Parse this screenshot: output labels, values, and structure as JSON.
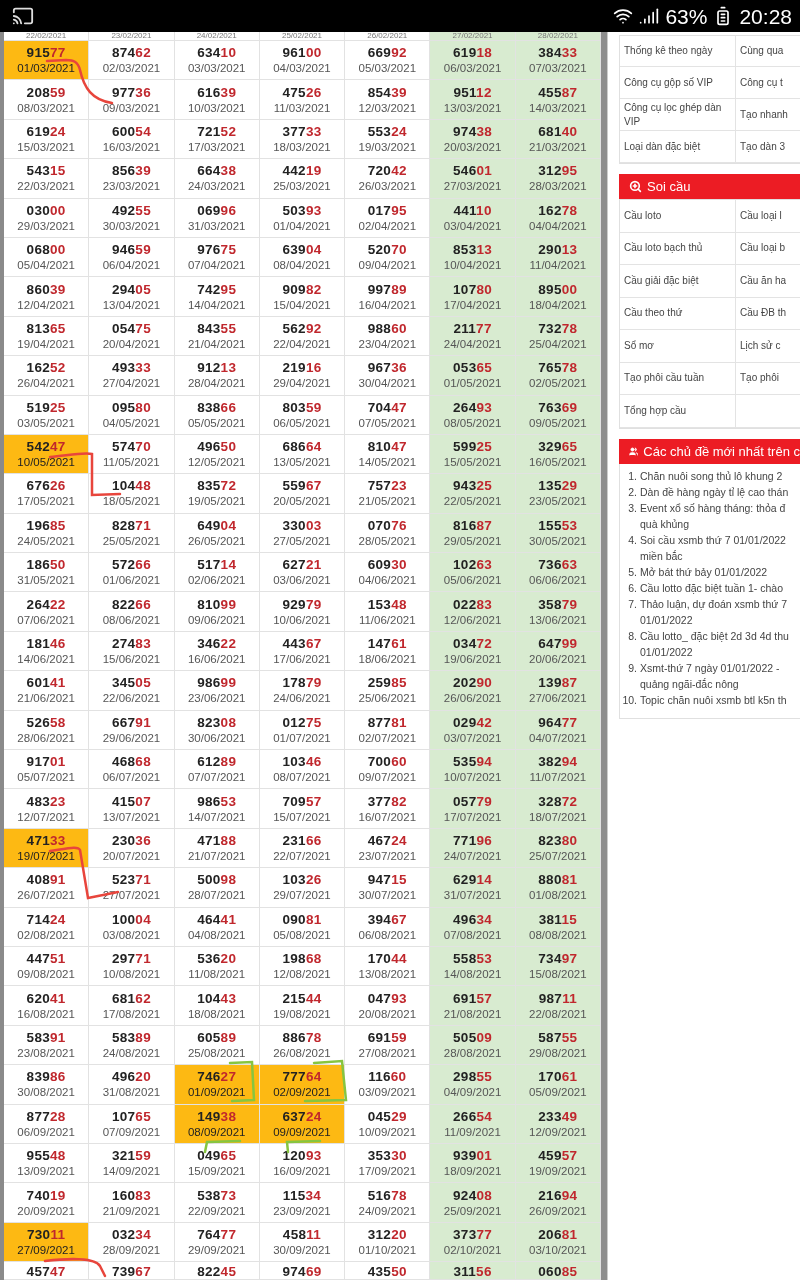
{
  "status_bar": {
    "battery": "63%",
    "time": "20:28"
  },
  "results": {
    "columns": [
      {
        "shaded": false
      },
      {
        "shaded": false
      },
      {
        "shaded": false
      },
      {
        "shaded": false
      },
      {
        "shaded": false
      },
      {
        "shaded": true
      },
      {
        "shaded": true
      }
    ],
    "top_row_dates": [
      "22/02/2021",
      "23/02/2021",
      "24/02/2021",
      "25/02/2021",
      "26/02/2021",
      "27/02/2021",
      "28/02/2021"
    ],
    "rows": [
      {
        "cells": [
          {
            "number": "91577",
            "date": "01/03/2021",
            "highlighted": true
          },
          {
            "number": "87462",
            "date": "02/03/2021",
            "highlighted": false
          },
          {
            "number": "63410",
            "date": "03/03/2021",
            "highlighted": false
          },
          {
            "number": "96100",
            "date": "04/03/2021",
            "highlighted": false
          },
          {
            "number": "66992",
            "date": "05/03/2021",
            "highlighted": false
          },
          {
            "number": "61918",
            "date": "06/03/2021",
            "highlighted": false
          },
          {
            "number": "38433",
            "date": "07/03/2021",
            "highlighted": false
          }
        ]
      },
      {
        "cells": [
          {
            "number": "20859",
            "date": "08/03/2021",
            "highlighted": false
          },
          {
            "number": "97736",
            "date": "09/03/2021",
            "highlighted": false
          },
          {
            "number": "61639",
            "date": "10/03/2021",
            "highlighted": false
          },
          {
            "number": "47526",
            "date": "11/03/2021",
            "highlighted": false
          },
          {
            "number": "85439",
            "date": "12/03/2021",
            "highlighted": false
          },
          {
            "number": "95112",
            "date": "13/03/2021",
            "highlighted": false
          },
          {
            "number": "45587",
            "date": "14/03/2021",
            "highlighted": false
          }
        ]
      },
      {
        "cells": [
          {
            "number": "61924",
            "date": "15/03/2021",
            "highlighted": false
          },
          {
            "number": "60054",
            "date": "16/03/2021",
            "highlighted": false
          },
          {
            "number": "72152",
            "date": "17/03/2021",
            "highlighted": false
          },
          {
            "number": "37733",
            "date": "18/03/2021",
            "highlighted": false
          },
          {
            "number": "55324",
            "date": "19/03/2021",
            "highlighted": false
          },
          {
            "number": "97438",
            "date": "20/03/2021",
            "highlighted": false
          },
          {
            "number": "68140",
            "date": "21/03/2021",
            "highlighted": false
          }
        ]
      },
      {
        "cells": [
          {
            "number": "54315",
            "date": "22/03/2021",
            "highlighted": false
          },
          {
            "number": "85639",
            "date": "23/03/2021",
            "highlighted": false
          },
          {
            "number": "66438",
            "date": "24/03/2021",
            "highlighted": false
          },
          {
            "number": "44219",
            "date": "25/03/2021",
            "highlighted": false
          },
          {
            "number": "72042",
            "date": "26/03/2021",
            "highlighted": false
          },
          {
            "number": "54601",
            "date": "27/03/2021",
            "highlighted": false
          },
          {
            "number": "31295",
            "date": "28/03/2021",
            "highlighted": false
          }
        ]
      },
      {
        "cells": [
          {
            "number": "03000",
            "date": "29/03/2021",
            "highlighted": false
          },
          {
            "number": "49255",
            "date": "30/03/2021",
            "highlighted": false
          },
          {
            "number": "06996",
            "date": "31/03/2021",
            "highlighted": false
          },
          {
            "number": "50393",
            "date": "01/04/2021",
            "highlighted": false
          },
          {
            "number": "01795",
            "date": "02/04/2021",
            "highlighted": false
          },
          {
            "number": "44110",
            "date": "03/04/2021",
            "highlighted": false
          },
          {
            "number": "16278",
            "date": "04/04/2021",
            "highlighted": false
          }
        ]
      },
      {
        "cells": [
          {
            "number": "06800",
            "date": "05/04/2021",
            "highlighted": false
          },
          {
            "number": "94659",
            "date": "06/04/2021",
            "highlighted": false
          },
          {
            "number": "97675",
            "date": "07/04/2021",
            "highlighted": false
          },
          {
            "number": "63904",
            "date": "08/04/2021",
            "highlighted": false
          },
          {
            "number": "52070",
            "date": "09/04/2021",
            "highlighted": false
          },
          {
            "number": "85313",
            "date": "10/04/2021",
            "highlighted": false
          },
          {
            "number": "29013",
            "date": "11/04/2021",
            "highlighted": false
          }
        ]
      },
      {
        "cells": [
          {
            "number": "86039",
            "date": "12/04/2021",
            "highlighted": false
          },
          {
            "number": "29405",
            "date": "13/04/2021",
            "highlighted": false
          },
          {
            "number": "74295",
            "date": "14/04/2021",
            "highlighted": false
          },
          {
            "number": "90982",
            "date": "15/04/2021",
            "highlighted": false
          },
          {
            "number": "99789",
            "date": "16/04/2021",
            "highlighted": false
          },
          {
            "number": "10780",
            "date": "17/04/2021",
            "highlighted": false
          },
          {
            "number": "89500",
            "date": "18/04/2021",
            "highlighted": false
          }
        ]
      },
      {
        "cells": [
          {
            "number": "81365",
            "date": "19/04/2021",
            "highlighted": false
          },
          {
            "number": "05475",
            "date": "20/04/2021",
            "highlighted": false
          },
          {
            "number": "84355",
            "date": "21/04/2021",
            "highlighted": false
          },
          {
            "number": "56292",
            "date": "22/04/2021",
            "highlighted": false
          },
          {
            "number": "98860",
            "date": "23/04/2021",
            "highlighted": false
          },
          {
            "number": "21177",
            "date": "24/04/2021",
            "highlighted": false
          },
          {
            "number": "73278",
            "date": "25/04/2021",
            "highlighted": false
          }
        ]
      },
      {
        "cells": [
          {
            "number": "16252",
            "date": "26/04/2021",
            "highlighted": false
          },
          {
            "number": "49333",
            "date": "27/04/2021",
            "highlighted": false
          },
          {
            "number": "91213",
            "date": "28/04/2021",
            "highlighted": false
          },
          {
            "number": "21916",
            "date": "29/04/2021",
            "highlighted": false
          },
          {
            "number": "96736",
            "date": "30/04/2021",
            "highlighted": false
          },
          {
            "number": "05365",
            "date": "01/05/2021",
            "highlighted": false
          },
          {
            "number": "76578",
            "date": "02/05/2021",
            "highlighted": false
          }
        ]
      },
      {
        "cells": [
          {
            "number": "51925",
            "date": "03/05/2021",
            "highlighted": false
          },
          {
            "number": "09580",
            "date": "04/05/2021",
            "highlighted": false
          },
          {
            "number": "83866",
            "date": "05/05/2021",
            "highlighted": false
          },
          {
            "number": "80359",
            "date": "06/05/2021",
            "highlighted": false
          },
          {
            "number": "70447",
            "date": "07/05/2021",
            "highlighted": false
          },
          {
            "number": "26493",
            "date": "08/05/2021",
            "highlighted": false
          },
          {
            "number": "76369",
            "date": "09/05/2021",
            "highlighted": false
          }
        ]
      },
      {
        "cells": [
          {
            "number": "54247",
            "date": "10/05/2021",
            "highlighted": true
          },
          {
            "number": "57470",
            "date": "11/05/2021",
            "highlighted": false
          },
          {
            "number": "49650",
            "date": "12/05/2021",
            "highlighted": false
          },
          {
            "number": "68664",
            "date": "13/05/2021",
            "highlighted": false
          },
          {
            "number": "81047",
            "date": "14/05/2021",
            "highlighted": false
          },
          {
            "number": "59925",
            "date": "15/05/2021",
            "highlighted": false
          },
          {
            "number": "32965",
            "date": "16/05/2021",
            "highlighted": false
          }
        ]
      },
      {
        "cells": [
          {
            "number": "67626",
            "date": "17/05/2021",
            "highlighted": false
          },
          {
            "number": "10448",
            "date": "18/05/2021",
            "highlighted": false
          },
          {
            "number": "83572",
            "date": "19/05/2021",
            "highlighted": false
          },
          {
            "number": "55967",
            "date": "20/05/2021",
            "highlighted": false
          },
          {
            "number": "75723",
            "date": "21/05/2021",
            "highlighted": false
          },
          {
            "number": "94325",
            "date": "22/05/2021",
            "highlighted": false
          },
          {
            "number": "13529",
            "date": "23/05/2021",
            "highlighted": false
          }
        ]
      },
      {
        "cells": [
          {
            "number": "19685",
            "date": "24/05/2021",
            "highlighted": false
          },
          {
            "number": "82871",
            "date": "25/05/2021",
            "highlighted": false
          },
          {
            "number": "64904",
            "date": "26/05/2021",
            "highlighted": false
          },
          {
            "number": "33003",
            "date": "27/05/2021",
            "highlighted": false
          },
          {
            "number": "07076",
            "date": "28/05/2021",
            "highlighted": false
          },
          {
            "number": "81687",
            "date": "29/05/2021",
            "highlighted": false
          },
          {
            "number": "15553",
            "date": "30/05/2021",
            "highlighted": false
          }
        ]
      },
      {
        "cells": [
          {
            "number": "18650",
            "date": "31/05/2021",
            "highlighted": false
          },
          {
            "number": "57266",
            "date": "01/06/2021",
            "highlighted": false
          },
          {
            "number": "51714",
            "date": "02/06/2021",
            "highlighted": false
          },
          {
            "number": "62721",
            "date": "03/06/2021",
            "highlighted": false
          },
          {
            "number": "60930",
            "date": "04/06/2021",
            "highlighted": false
          },
          {
            "number": "10263",
            "date": "05/06/2021",
            "highlighted": false
          },
          {
            "number": "73663",
            "date": "06/06/2021",
            "highlighted": false
          }
        ]
      },
      {
        "cells": [
          {
            "number": "26422",
            "date": "07/06/2021",
            "highlighted": false
          },
          {
            "number": "82266",
            "date": "08/06/2021",
            "highlighted": false
          },
          {
            "number": "81099",
            "date": "09/06/2021",
            "highlighted": false
          },
          {
            "number": "92979",
            "date": "10/06/2021",
            "highlighted": false
          },
          {
            "number": "15348",
            "date": "11/06/2021",
            "highlighted": false
          },
          {
            "number": "02283",
            "date": "12/06/2021",
            "highlighted": false
          },
          {
            "number": "35879",
            "date": "13/06/2021",
            "highlighted": false
          }
        ]
      },
      {
        "cells": [
          {
            "number": "18146",
            "date": "14/06/2021",
            "highlighted": false
          },
          {
            "number": "27483",
            "date": "15/06/2021",
            "highlighted": false
          },
          {
            "number": "34622",
            "date": "16/06/2021",
            "highlighted": false
          },
          {
            "number": "44367",
            "date": "17/06/2021",
            "highlighted": false
          },
          {
            "number": "14761",
            "date": "18/06/2021",
            "highlighted": false
          },
          {
            "number": "03472",
            "date": "19/06/2021",
            "highlighted": false
          },
          {
            "number": "64799",
            "date": "20/06/2021",
            "highlighted": false
          }
        ]
      },
      {
        "cells": [
          {
            "number": "60141",
            "date": "21/06/2021",
            "highlighted": false
          },
          {
            "number": "34505",
            "date": "22/06/2021",
            "highlighted": false
          },
          {
            "number": "98699",
            "date": "23/06/2021",
            "highlighted": false
          },
          {
            "number": "17879",
            "date": "24/06/2021",
            "highlighted": false
          },
          {
            "number": "25985",
            "date": "25/06/2021",
            "highlighted": false
          },
          {
            "number": "20290",
            "date": "26/06/2021",
            "highlighted": false
          },
          {
            "number": "13987",
            "date": "27/06/2021",
            "highlighted": false
          }
        ]
      },
      {
        "cells": [
          {
            "number": "52658",
            "date": "28/06/2021",
            "highlighted": false
          },
          {
            "number": "66791",
            "date": "29/06/2021",
            "highlighted": false
          },
          {
            "number": "82308",
            "date": "30/06/2021",
            "highlighted": false
          },
          {
            "number": "01275",
            "date": "01/07/2021",
            "highlighted": false
          },
          {
            "number": "87781",
            "date": "02/07/2021",
            "highlighted": false
          },
          {
            "number": "02942",
            "date": "03/07/2021",
            "highlighted": false
          },
          {
            "number": "96477",
            "date": "04/07/2021",
            "highlighted": false
          }
        ]
      },
      {
        "cells": [
          {
            "number": "91701",
            "date": "05/07/2021",
            "highlighted": false
          },
          {
            "number": "46868",
            "date": "06/07/2021",
            "highlighted": false
          },
          {
            "number": "61289",
            "date": "07/07/2021",
            "highlighted": false
          },
          {
            "number": "10346",
            "date": "08/07/2021",
            "highlighted": false
          },
          {
            "number": "70060",
            "date": "09/07/2021",
            "highlighted": false
          },
          {
            "number": "53594",
            "date": "10/07/2021",
            "highlighted": false
          },
          {
            "number": "38294",
            "date": "11/07/2021",
            "highlighted": false
          }
        ]
      },
      {
        "cells": [
          {
            "number": "48323",
            "date": "12/07/2021",
            "highlighted": false
          },
          {
            "number": "41507",
            "date": "13/07/2021",
            "highlighted": false
          },
          {
            "number": "98653",
            "date": "14/07/2021",
            "highlighted": false
          },
          {
            "number": "70957",
            "date": "15/07/2021",
            "highlighted": false
          },
          {
            "number": "37782",
            "date": "16/07/2021",
            "highlighted": false
          },
          {
            "number": "05779",
            "date": "17/07/2021",
            "highlighted": false
          },
          {
            "number": "32872",
            "date": "18/07/2021",
            "highlighted": false
          }
        ]
      },
      {
        "cells": [
          {
            "number": "47133",
            "date": "19/07/2021",
            "highlighted": true
          },
          {
            "number": "23036",
            "date": "20/07/2021",
            "highlighted": false
          },
          {
            "number": "47188",
            "date": "21/07/2021",
            "highlighted": false
          },
          {
            "number": "23166",
            "date": "22/07/2021",
            "highlighted": false
          },
          {
            "number": "46724",
            "date": "23/07/2021",
            "highlighted": false
          },
          {
            "number": "77196",
            "date": "24/07/2021",
            "highlighted": false
          },
          {
            "number": "82380",
            "date": "25/07/2021",
            "highlighted": false
          }
        ]
      },
      {
        "cells": [
          {
            "number": "40891",
            "date": "26/07/2021",
            "highlighted": false
          },
          {
            "number": "52371",
            "date": "27/07/2021",
            "highlighted": false
          },
          {
            "number": "50098",
            "date": "28/07/2021",
            "highlighted": false
          },
          {
            "number": "10326",
            "date": "29/07/2021",
            "highlighted": false
          },
          {
            "number": "94715",
            "date": "30/07/2021",
            "highlighted": false
          },
          {
            "number": "62914",
            "date": "31/07/2021",
            "highlighted": false
          },
          {
            "number": "88081",
            "date": "01/08/2021",
            "highlighted": false
          }
        ]
      },
      {
        "cells": [
          {
            "number": "71424",
            "date": "02/08/2021",
            "highlighted": false
          },
          {
            "number": "10004",
            "date": "03/08/2021",
            "highlighted": false
          },
          {
            "number": "46441",
            "date": "04/08/2021",
            "highlighted": false
          },
          {
            "number": "09081",
            "date": "05/08/2021",
            "highlighted": false
          },
          {
            "number": "39467",
            "date": "06/08/2021",
            "highlighted": false
          },
          {
            "number": "49634",
            "date": "07/08/2021",
            "highlighted": false
          },
          {
            "number": "38115",
            "date": "08/08/2021",
            "highlighted": false
          }
        ]
      },
      {
        "cells": [
          {
            "number": "44751",
            "date": "09/08/2021",
            "highlighted": false
          },
          {
            "number": "29771",
            "date": "10/08/2021",
            "highlighted": false
          },
          {
            "number": "53620",
            "date": "11/08/2021",
            "highlighted": false
          },
          {
            "number": "19868",
            "date": "12/08/2021",
            "highlighted": false
          },
          {
            "number": "17044",
            "date": "13/08/2021",
            "highlighted": false
          },
          {
            "number": "55853",
            "date": "14/08/2021",
            "highlighted": false
          },
          {
            "number": "73497",
            "date": "15/08/2021",
            "highlighted": false
          }
        ]
      },
      {
        "cells": [
          {
            "number": "62041",
            "date": "16/08/2021",
            "highlighted": false
          },
          {
            "number": "68162",
            "date": "17/08/2021",
            "highlighted": false
          },
          {
            "number": "10443",
            "date": "18/08/2021",
            "highlighted": false
          },
          {
            "number": "21544",
            "date": "19/08/2021",
            "highlighted": false
          },
          {
            "number": "04793",
            "date": "20/08/2021",
            "highlighted": false
          },
          {
            "number": "69157",
            "date": "21/08/2021",
            "highlighted": false
          },
          {
            "number": "98711",
            "date": "22/08/2021",
            "highlighted": false
          }
        ]
      },
      {
        "cells": [
          {
            "number": "58391",
            "date": "23/08/2021",
            "highlighted": false
          },
          {
            "number": "58389",
            "date": "24/08/2021",
            "highlighted": false
          },
          {
            "number": "60589",
            "date": "25/08/2021",
            "highlighted": false
          },
          {
            "number": "88678",
            "date": "26/08/2021",
            "highlighted": false
          },
          {
            "number": "69159",
            "date": "27/08/2021",
            "highlighted": false
          },
          {
            "number": "50509",
            "date": "28/08/2021",
            "highlighted": false
          },
          {
            "number": "58755",
            "date": "29/08/2021",
            "highlighted": false
          }
        ]
      },
      {
        "cells": [
          {
            "number": "83986",
            "date": "30/08/2021",
            "highlighted": false
          },
          {
            "number": "49620",
            "date": "31/08/2021",
            "highlighted": false
          },
          {
            "number": "74627",
            "date": "01/09/2021",
            "highlighted": true
          },
          {
            "number": "77764",
            "date": "02/09/2021",
            "highlighted": true
          },
          {
            "number": "11660",
            "date": "03/09/2021",
            "highlighted": false
          },
          {
            "number": "29855",
            "date": "04/09/2021",
            "highlighted": false
          },
          {
            "number": "17061",
            "date": "05/09/2021",
            "highlighted": false
          }
        ]
      },
      {
        "cells": [
          {
            "number": "87728",
            "date": "06/09/2021",
            "highlighted": false
          },
          {
            "number": "10765",
            "date": "07/09/2021",
            "highlighted": false
          },
          {
            "number": "14938",
            "date": "08/09/2021",
            "highlighted": true
          },
          {
            "number": "63724",
            "date": "09/09/2021",
            "highlighted": true
          },
          {
            "number": "04529",
            "date": "10/09/2021",
            "highlighted": false
          },
          {
            "number": "26654",
            "date": "11/09/2021",
            "highlighted": false
          },
          {
            "number": "23349",
            "date": "12/09/2021",
            "highlighted": false
          }
        ]
      },
      {
        "cells": [
          {
            "number": "95548",
            "date": "13/09/2021",
            "highlighted": false
          },
          {
            "number": "32159",
            "date": "14/09/2021",
            "highlighted": false
          },
          {
            "number": "04965",
            "date": "15/09/2021",
            "highlighted": false
          },
          {
            "number": "12093",
            "date": "16/09/2021",
            "highlighted": false
          },
          {
            "number": "35330",
            "date": "17/09/2021",
            "highlighted": false
          },
          {
            "number": "93901",
            "date": "18/09/2021",
            "highlighted": false
          },
          {
            "number": "45957",
            "date": "19/09/2021",
            "highlighted": false
          }
        ]
      },
      {
        "cells": [
          {
            "number": "74019",
            "date": "20/09/2021",
            "highlighted": false
          },
          {
            "number": "16083",
            "date": "21/09/2021",
            "highlighted": false
          },
          {
            "number": "53873",
            "date": "22/09/2021",
            "highlighted": false
          },
          {
            "number": "11534",
            "date": "23/09/2021",
            "highlighted": false
          },
          {
            "number": "51678",
            "date": "24/09/2021",
            "highlighted": false
          },
          {
            "number": "92408",
            "date": "25/09/2021",
            "highlighted": false
          },
          {
            "number": "21694",
            "date": "26/09/2021",
            "highlighted": false
          }
        ]
      },
      {
        "cells": [
          {
            "number": "73011",
            "date": "27/09/2021",
            "highlighted": true
          },
          {
            "number": "03234",
            "date": "28/09/2021",
            "highlighted": false
          },
          {
            "number": "76477",
            "date": "29/09/2021",
            "highlighted": false
          },
          {
            "number": "45811",
            "date": "30/09/2021",
            "highlighted": false
          },
          {
            "number": "31220",
            "date": "01/10/2021",
            "highlighted": false
          },
          {
            "number": "37377",
            "date": "02/10/2021",
            "highlighted": false
          },
          {
            "number": "20681",
            "date": "03/10/2021",
            "highlighted": false
          }
        ]
      }
    ],
    "bottom_row_numbers": [
      "45747",
      "73967",
      "82245",
      "97469",
      "43550",
      "31156",
      "06085"
    ],
    "annotations": [
      {
        "color": "#e8453c"
      },
      {
        "color": "#e8453c"
      },
      {
        "color": "#e8453c"
      },
      {
        "color": "#e8453c"
      },
      {
        "color": "#86c540"
      },
      {
        "color": "#86c540"
      },
      {
        "color": "#86c540"
      },
      {
        "color": "#86c540"
      }
    ]
  },
  "side_panel": {
    "tools": {
      "rows": [
        {
          "left": "Thống kê theo ngày",
          "right": "Cùng qua"
        },
        {
          "left": "Công cụ gộp số VIP",
          "right": "Công cụ t"
        },
        {
          "left": "Công cụ lọc ghép dàn VIP",
          "right": "Tạo nhanh"
        },
        {
          "left": "Loại dàn đặc biệt",
          "right": "Tạo dàn 3"
        }
      ]
    },
    "soi_cau": {
      "title": "Soi cầu",
      "rows": [
        {
          "left": "Cầu loto",
          "right": "Cầu loại l"
        },
        {
          "left": "Cầu loto bạch thủ",
          "right": "Cầu loại b"
        },
        {
          "left": "Cầu giải đặc biệt",
          "right": "Cầu ăn ha"
        },
        {
          "left": "Cầu theo thứ",
          "right": "Cầu ĐB th"
        },
        {
          "left": "Sổ mơ",
          "right": "Lịch sử c"
        },
        {
          "left": "Tạo phôi cầu tuần",
          "right": "Tạo phôi"
        },
        {
          "left": "Tổng hợp cầu"
        }
      ]
    },
    "topics": {
      "title": "Các chủ đề mới nhất trên c",
      "items": [
        {
          "number": "1.",
          "lines": [
            "Chăn nuôi song thủ lô khung 2"
          ]
        },
        {
          "number": "2.",
          "lines": [
            "Dàn đề hàng ngày tỉ lệ cao thán"
          ]
        },
        {
          "number": "3.",
          "lines": [
            "Event xổ số hàng tháng: thỏa đ",
            "quà khủng"
          ]
        },
        {
          "number": "4.",
          "lines": [
            "Soi cầu xsmb thứ 7 01/01/2022",
            "miền bắc"
          ]
        },
        {
          "number": "5.",
          "lines": [
            "Mở bát thứ bảy 01/01/2022"
          ]
        },
        {
          "number": "6.",
          "lines": [
            "Cầu lotto đặc biệt tuần 1- chào"
          ]
        },
        {
          "number": "7.",
          "lines": [
            "Thảo luận, dự đoán xsmb thứ 7",
            "01/01/2022"
          ]
        },
        {
          "number": "8.",
          "lines": [
            "Cầu lotto_ đặc biệt 2d 3d 4d thu",
            "01/01/2022"
          ]
        },
        {
          "number": "9.",
          "lines": [
            "Xsmt-thứ 7 ngày 01/01/2022 -",
            "quảng ngãi-đắc nông"
          ]
        },
        {
          "number": "10.",
          "lines": [
            "Topic chăn nuôi xsmb btl k5n th"
          ]
        }
      ]
    }
  }
}
